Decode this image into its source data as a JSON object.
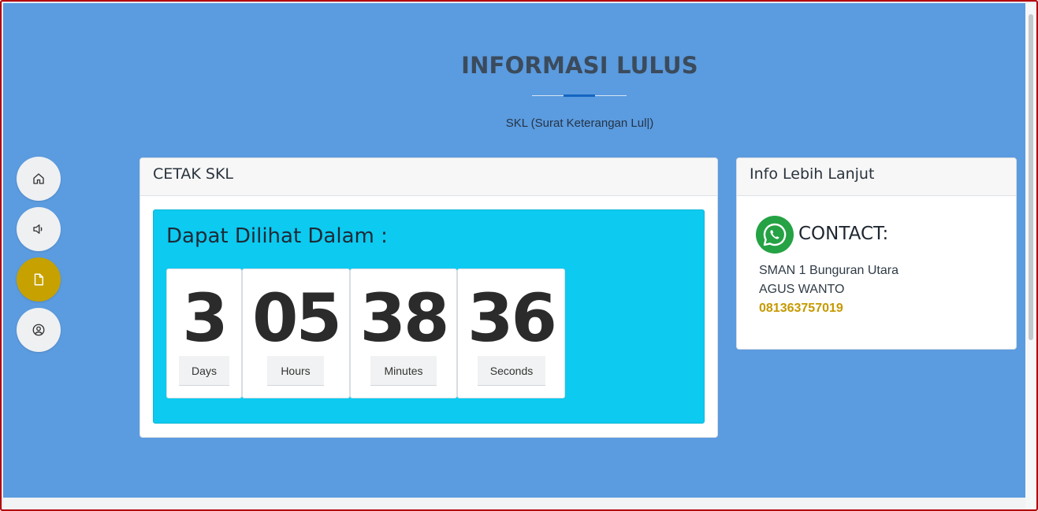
{
  "header": {
    "title": "INFORMASI LULUS",
    "subtitle": "SKL (Surat Keterangan Lul|)"
  },
  "sidebar": {
    "items": [
      {
        "name": "home",
        "icon": "home-icon",
        "active": false
      },
      {
        "name": "announcement",
        "icon": "speaker-icon",
        "active": false
      },
      {
        "name": "document",
        "icon": "document-icon",
        "active": true
      },
      {
        "name": "profile",
        "icon": "user-circle-icon",
        "active": false
      }
    ]
  },
  "cetak_card": {
    "title": "CETAK SKL",
    "heading": "Dapat Dilihat Dalam :",
    "countdown": [
      {
        "value": "3",
        "label": "Days"
      },
      {
        "value": "05",
        "label": "Hours"
      },
      {
        "value": "38",
        "label": "Minutes"
      },
      {
        "value": "36",
        "label": "Seconds"
      }
    ]
  },
  "info_card": {
    "title": "Info Lebih Lanjut",
    "contact_label": "CONTACT:",
    "school": "SMAN 1 Bunguran Utara",
    "person": "AGUS WANTO",
    "phone": "081363757019",
    "icon": "whatsapp-icon"
  },
  "colors": {
    "background": "#5b9bdf",
    "accent": "#1465c2",
    "countdown_panel": "#0dcaf0",
    "active_button": "#c6a100",
    "phone": "#c59900",
    "whatsapp": "#25a244"
  }
}
